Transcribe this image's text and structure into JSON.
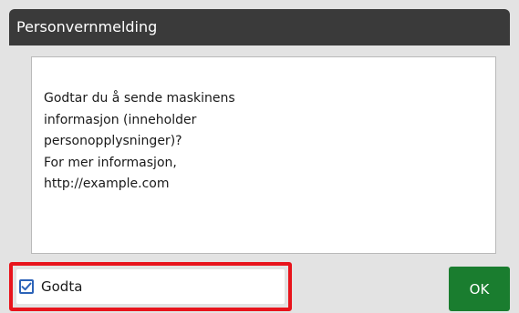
{
  "dialog": {
    "title": "Personvernmelding",
    "message_lines": [
      "Godtar du å sende maskinens",
      "informasjon (inneholder",
      "personopplysninger)?",
      "For mer informasjon,",
      "http://example.com"
    ],
    "accept_checkbox": {
      "label": "Godta",
      "checked": true
    },
    "ok_label": "OK"
  },
  "colors": {
    "title_bar": "#3a3a3a",
    "background": "#e3e3e3",
    "highlight_border": "#e8141c",
    "checkbox_accent": "#2c63b8",
    "ok_button": "#1a7d2f"
  },
  "icons": {
    "checkbox_mark": "check-icon"
  }
}
